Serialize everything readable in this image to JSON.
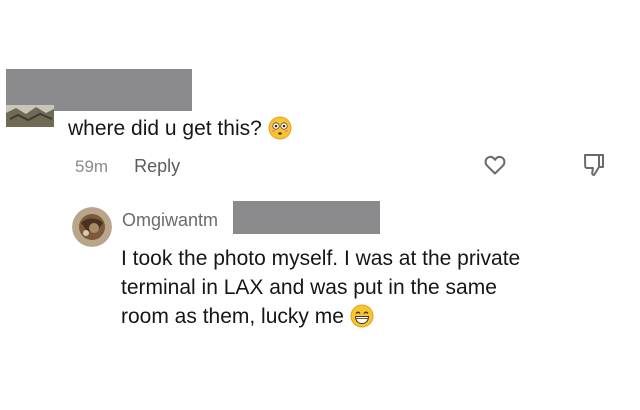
{
  "parent_comment": {
    "text": "where did u get this?",
    "emoji": "flushed-face-emoji",
    "time": "59m",
    "reply_label": "Reply"
  },
  "reply_comment": {
    "username": "Omgiwantm",
    "text_lines": [
      "I took the photo myself. I was at the private",
      "terminal in LAX and was put in the same",
      "room as them, lucky me"
    ],
    "emoji": "grinning-face-emoji"
  },
  "icons": {
    "like": "heart-icon",
    "dislike": "thumbs-down-icon"
  },
  "colors": {
    "redaction": "#8b8b8d",
    "text": "#161616",
    "meta": "#8a8a8a",
    "emoji_yellow": "#f7c531"
  }
}
